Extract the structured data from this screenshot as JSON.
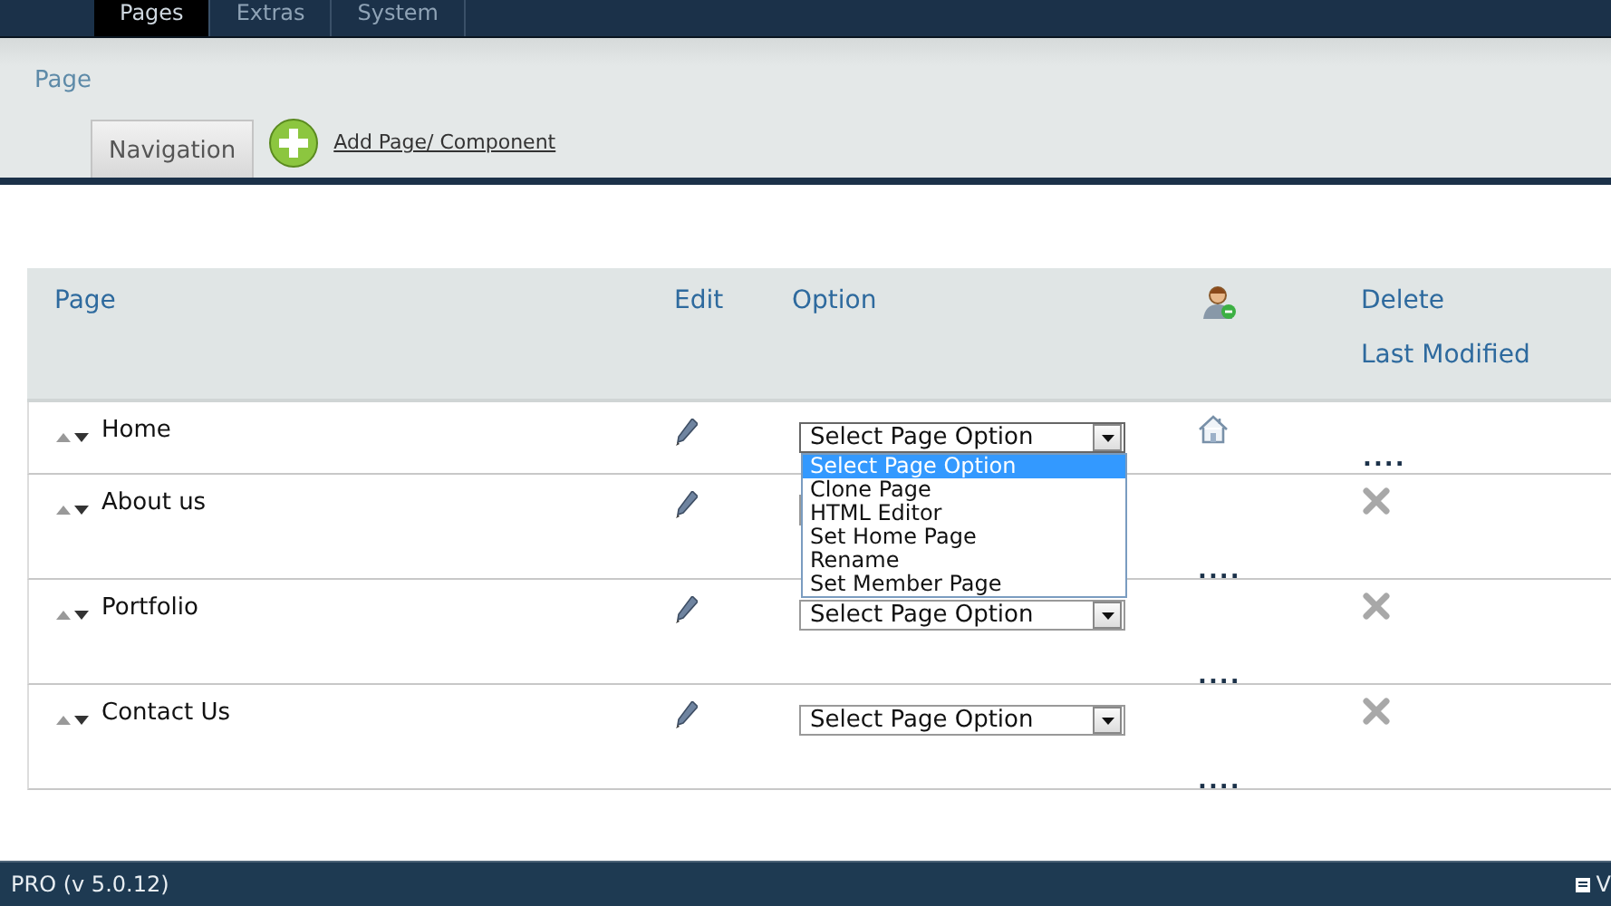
{
  "top_tabs": [
    {
      "label": "Pages",
      "selected": true
    },
    {
      "label": "Extras",
      "selected": false
    },
    {
      "label": "System",
      "selected": false
    }
  ],
  "page_title": "Page",
  "sub_tabs": [
    {
      "label": "Navigation",
      "selected": true
    }
  ],
  "add_link": "Add Page/ Component",
  "table": {
    "columns": [
      "Page",
      "Edit",
      "Option"
    ],
    "delete_label": "Delete",
    "last_modified_label": "Last Modified",
    "rows": [
      {
        "name": "Home",
        "kind": "home",
        "option": "Select Page Option",
        "last_modified": "....",
        "dropdown_open": true
      },
      {
        "name": "About us",
        "kind": "deletable",
        "last_modified": "....",
        "dropdown_open": false
      },
      {
        "name": "Portfolio",
        "kind": "deletable",
        "option": "Select Page Option",
        "last_modified": "....",
        "dropdown_open": false
      },
      {
        "name": "Contact Us",
        "kind": "deletable",
        "option": "Select Page Option",
        "last_modified": "....",
        "dropdown_open": false
      }
    ]
  },
  "dropdown_options": [
    {
      "label": "Select Page Option",
      "selected": true
    },
    {
      "label": "Clone Page",
      "selected": false
    },
    {
      "label": "HTML Editor",
      "selected": false
    },
    {
      "label": "Set Home Page",
      "selected": false
    },
    {
      "label": "Rename",
      "selected": false
    },
    {
      "label": "Set Member Page",
      "selected": false
    }
  ],
  "footer": {
    "version": "PRO (v 5.0.12)",
    "right_text": "V"
  }
}
